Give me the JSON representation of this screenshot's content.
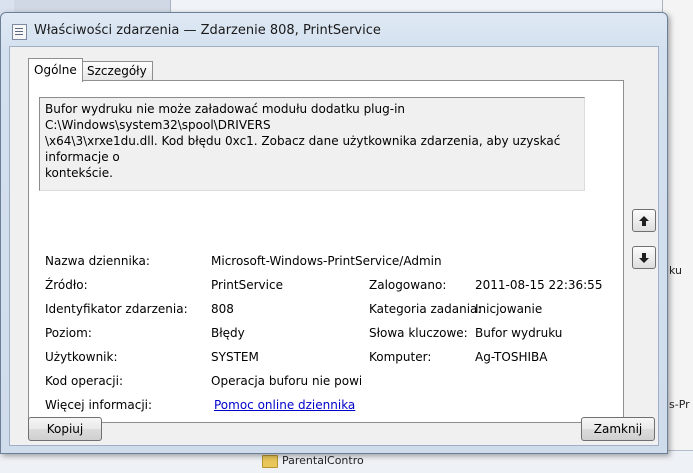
{
  "window": {
    "title": "Właściwości zdarzenia — Zdarzenie 808, PrintService"
  },
  "tabs": [
    {
      "label": "Ogólne",
      "active": true
    },
    {
      "label": "Szczegóły",
      "active": false
    }
  ],
  "description": "Bufor wydruku nie może załadować modułu dodatku plug-in C:\\Windows\\system32\\spool\\DRIVERS\n\\x64\\3\\xrxe1du.dll. Kod błędu 0xc1. Zobacz dane użytkownika zdarzenia, aby uzyskać informacje o\nkontekście.",
  "fields": {
    "log_name": {
      "label": "Nazwa dziennika:",
      "value": "Microsoft-Windows-PrintService/Admin"
    },
    "source": {
      "label": "Źródło:",
      "value": "PrintService"
    },
    "logged": {
      "label": "Zalogowano:",
      "value": "2011-08-15 22:36:55"
    },
    "event_id": {
      "label": "Identyfikator zdarzenia:",
      "value": "808"
    },
    "task_category": {
      "label": "Kategoria zadania:",
      "value": "Inicjowanie"
    },
    "level": {
      "label": "Poziom:",
      "value": "Błędy"
    },
    "keywords": {
      "label": "Słowa kluczowe:",
      "value": "Bufor wydruku"
    },
    "user": {
      "label": "Użytkownik:",
      "value": "SYSTEM"
    },
    "computer": {
      "label": "Komputer:",
      "value": "Ag-TOSHIBA"
    },
    "opcode": {
      "label": "Kod operacji:",
      "value": "Operacja buforu nie powiodł"
    },
    "more_info": {
      "label": "Więcej informacji:",
      "value": "Pomoc online dziennika"
    }
  },
  "buttons": {
    "copy": "Kopiuj",
    "close": "Zamknij"
  },
  "background": {
    "right_fragments": [
      "ku",
      "s-Pr"
    ],
    "bottom_item": "ParentalContro"
  },
  "icons": {
    "title": "event-properties-icon",
    "up": "arrow-up-icon",
    "down": "arrow-down-icon"
  }
}
